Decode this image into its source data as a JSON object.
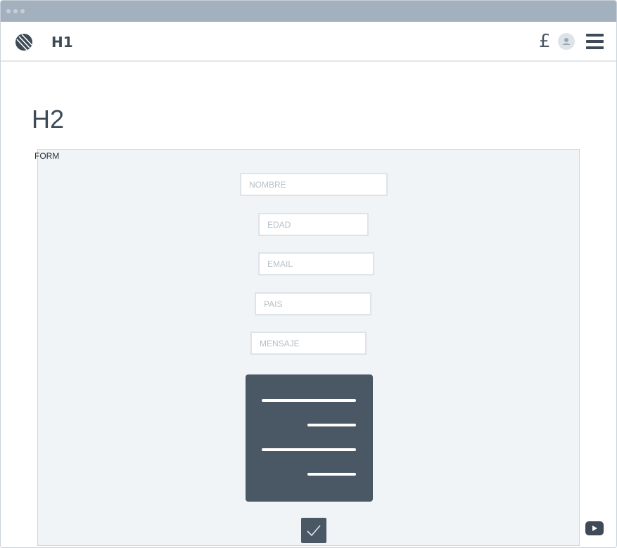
{
  "header": {
    "title": "H1",
    "currency_symbol": "£",
    "logo_icon": "globe-logo-icon",
    "avatar_icon": "user-avatar-icon",
    "menu_icon": "hamburger-menu-icon"
  },
  "page": {
    "heading": "H2"
  },
  "form": {
    "label": "FORM",
    "fields": {
      "nombre": {
        "placeholder": "NOMBRE"
      },
      "edad": {
        "placeholder": "EDAD"
      },
      "email": {
        "placeholder": "EMAIL"
      },
      "pais": {
        "placeholder": "PAIS"
      },
      "mensaje": {
        "placeholder": "MENSAJE"
      }
    },
    "text_block_icon": "align-right-text-icon",
    "checkbox_icon": "checkmark-icon",
    "checked": true
  },
  "footer": {
    "video_icon": "youtube-play-icon"
  },
  "colors": {
    "titlebar": "#a3b1bf",
    "dark": "#4a5866",
    "form_bg": "#f1f4f7"
  }
}
